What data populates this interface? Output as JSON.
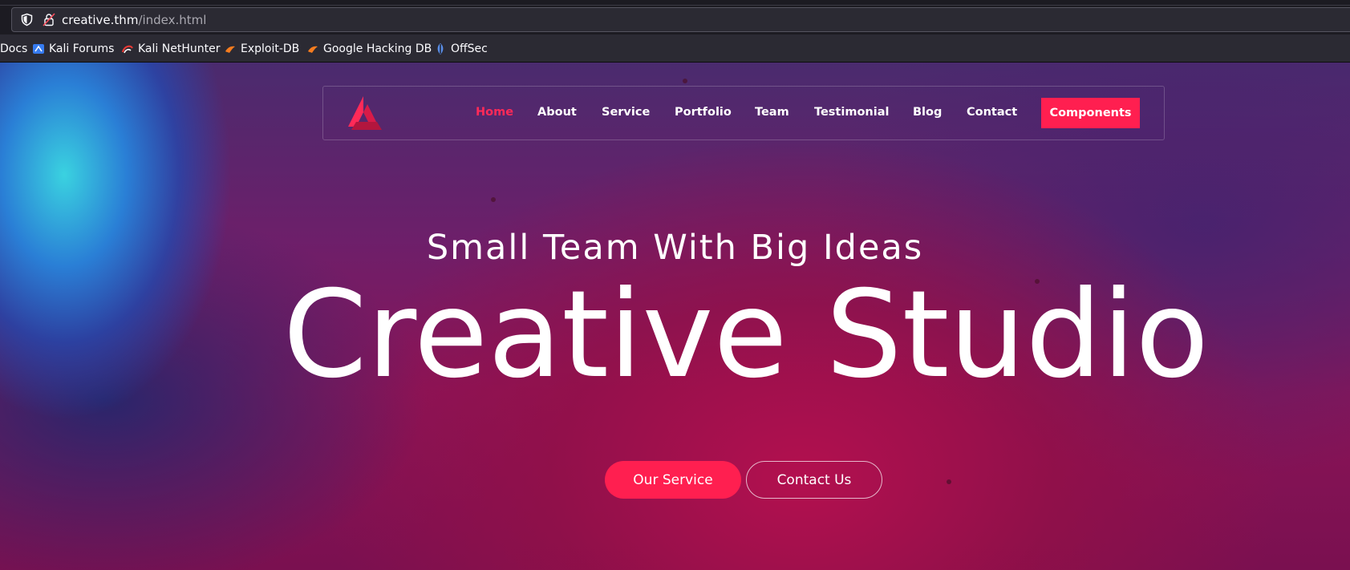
{
  "browser": {
    "url_host": "creative.thm",
    "url_path": "/index.html",
    "bookmarks": [
      {
        "label": "Docs",
        "icon": "kali-docs-icon"
      },
      {
        "label": "Kali Forums",
        "icon": "kali-forums-icon"
      },
      {
        "label": "Kali NetHunter",
        "icon": "nethunter-icon"
      },
      {
        "label": "Exploit-DB",
        "icon": "exploit-db-icon"
      },
      {
        "label": "Google Hacking DB",
        "icon": "ghdb-icon"
      },
      {
        "label": "OffSec",
        "icon": "offsec-icon"
      }
    ]
  },
  "nav": {
    "items": [
      "Home",
      "About",
      "Service",
      "Portfolio",
      "Team",
      "Testimonial",
      "Blog",
      "Contact"
    ],
    "active": "Home",
    "cta": "Components"
  },
  "hero": {
    "subtitle": "Small Team With Big Ideas",
    "title": "Creative Studio",
    "primary_button": "Our Service",
    "secondary_button": "Contact Us"
  },
  "colors": {
    "accent": "#ff1f50",
    "active_nav": "#ff2a58"
  }
}
